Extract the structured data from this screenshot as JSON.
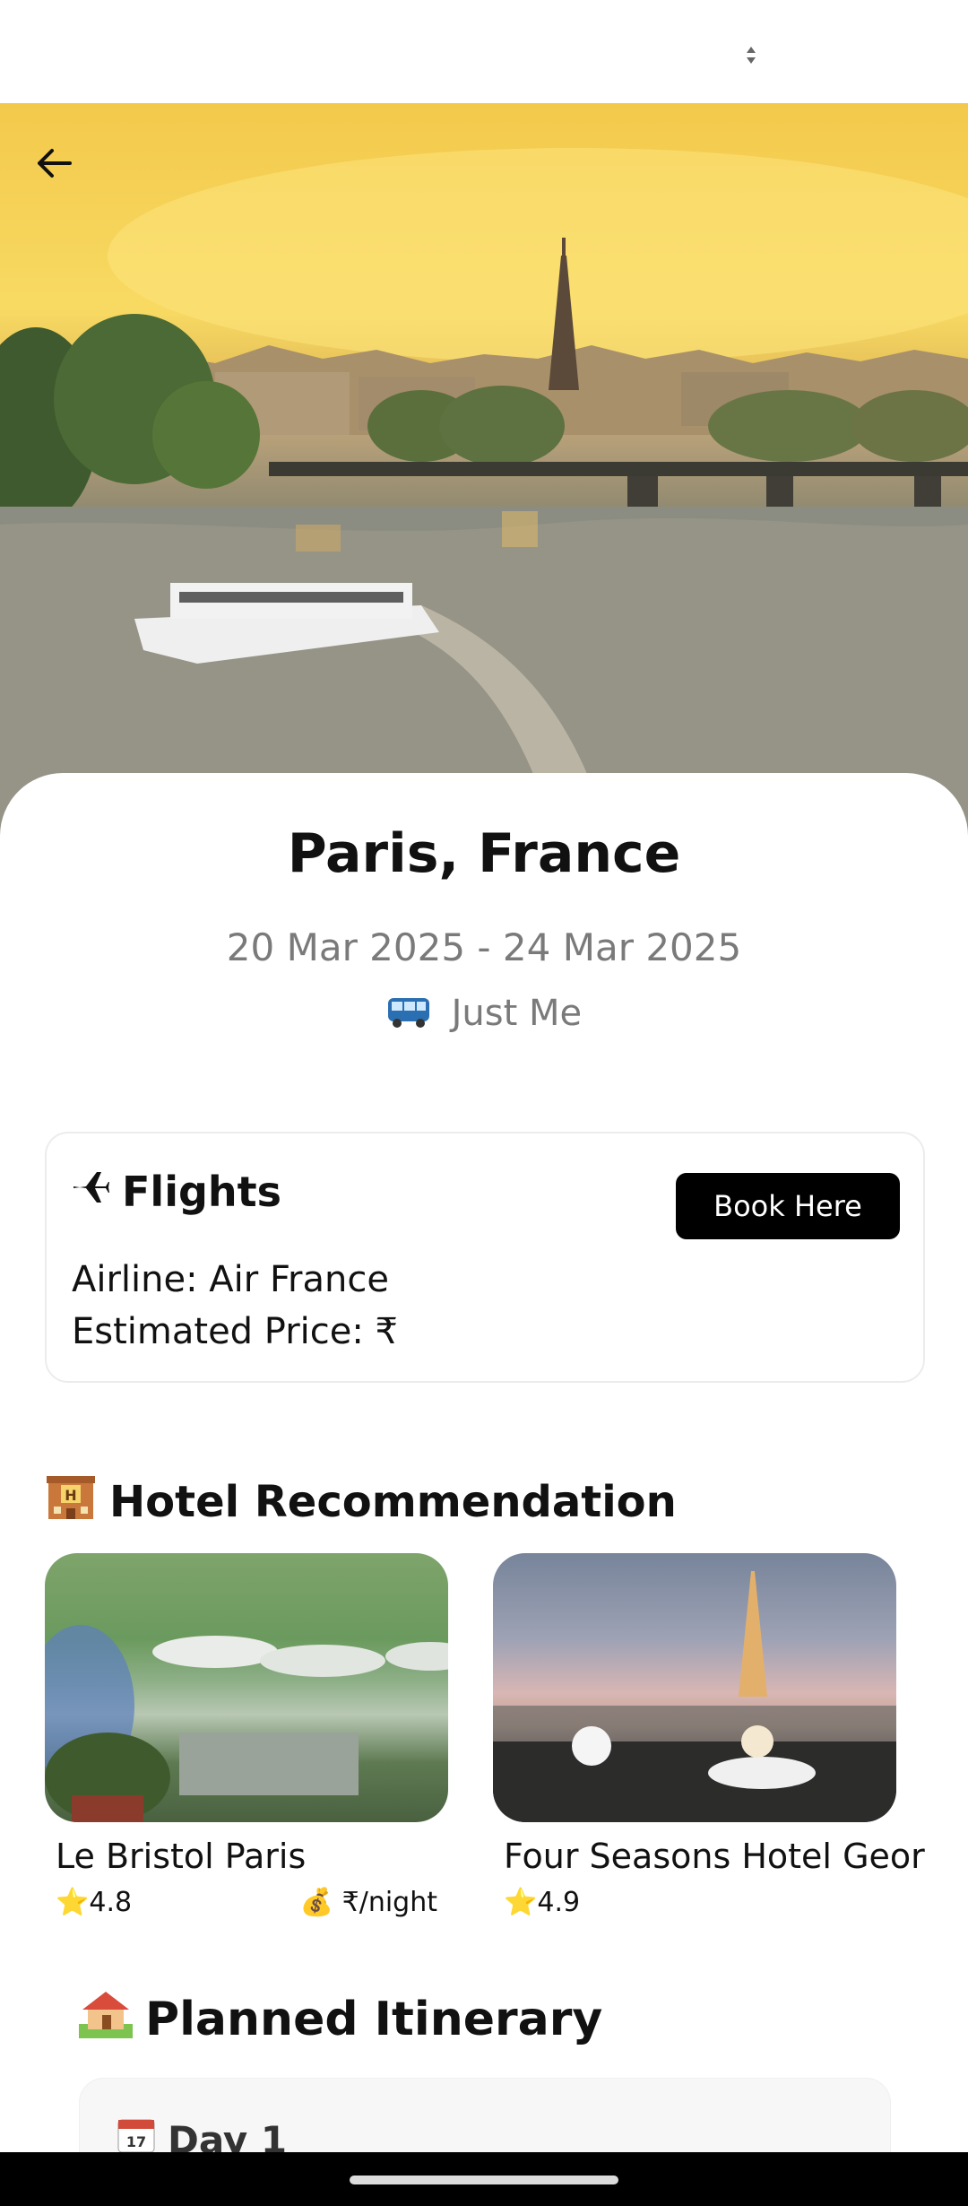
{
  "trip": {
    "title": "Paris, France",
    "dates": "20 Mar 2025 - 24 Mar 2025",
    "travelers": "Just Me"
  },
  "flights": {
    "title": "Flights",
    "book_label": "Book Here",
    "airline_line": "Airline: Air France",
    "price_line": "Estimated Price: ₹"
  },
  "hotels": {
    "section_title": "Hotel Recommendation",
    "items": [
      {
        "name": "Le Bristol Paris",
        "rating": "4.8",
        "price": "₹/night"
      },
      {
        "name": "Four Seasons Hotel Geor",
        "rating": "4.9"
      }
    ]
  },
  "itinerary": {
    "section_title": "Planned Itinerary",
    "days": [
      {
        "label": "Day 1"
      }
    ]
  },
  "icons": {
    "back": "arrow-left-icon",
    "bus": "bus-icon",
    "plane": "airplane-icon",
    "hotel": "hotel-icon",
    "star": "star-icon",
    "money": "money-bag-icon",
    "house": "house-icon",
    "calendar": "calendar-icon"
  }
}
